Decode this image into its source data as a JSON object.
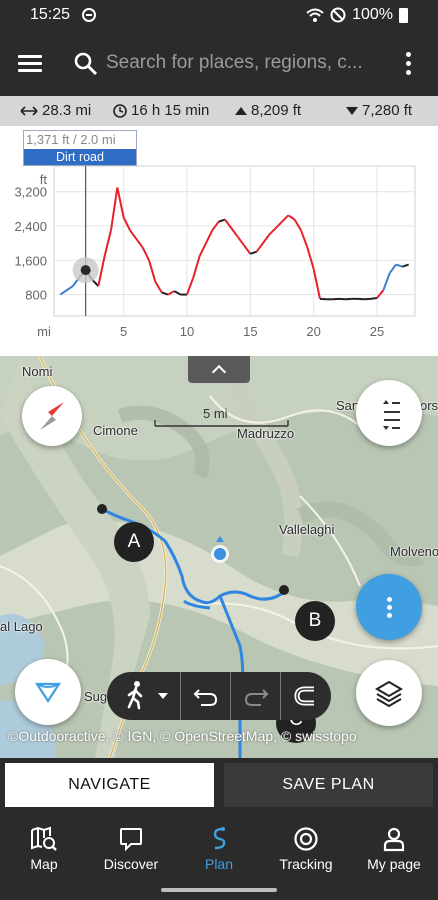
{
  "status_bar": {
    "time": "15:25",
    "battery": "100%"
  },
  "app_bar": {
    "search_placeholder": "Search for places, regions, c..."
  },
  "stats": {
    "distance": "28.3 mi",
    "duration": "16 h 15 min",
    "ascent": "8,209 ft",
    "descent": "7,280 ft"
  },
  "tooltip": {
    "value": "1,371 ft / 2.0 mi",
    "surface": "Dirt road"
  },
  "chart_data": {
    "type": "line",
    "title": "",
    "xlabel": "mi",
    "ylabel": "ft",
    "xlim": [
      -0.5,
      28
    ],
    "ylim": [
      300,
      3800
    ],
    "x_ticks": [
      5,
      10,
      15,
      20,
      25
    ],
    "y_ticks": [
      800,
      1600,
      2400,
      3200
    ],
    "x": [
      0,
      1,
      1.5,
      2,
      2.5,
      3,
      3.5,
      4,
      4.5,
      5,
      5.5,
      6,
      6.5,
      7,
      7.5,
      8,
      8.5,
      9,
      9.5,
      10,
      10.5,
      11,
      11.5,
      12,
      12.5,
      13,
      13.5,
      14,
      14.5,
      15,
      15.5,
      16,
      16.5,
      17,
      17.5,
      18,
      18.5,
      19,
      19.5,
      20,
      20.5,
      21,
      21.5,
      22,
      22.5,
      23,
      23.5,
      24,
      24.5,
      25,
      25.5,
      26,
      26.5,
      27,
      27.5
    ],
    "elevation": [
      800,
      1000,
      1200,
      1371,
      1150,
      1000,
      1700,
      2300,
      3300,
      2600,
      2300,
      2100,
      1900,
      1600,
      1100,
      850,
      800,
      880,
      800,
      800,
      1200,
      1700,
      2000,
      2300,
      2500,
      2550,
      2350,
      2150,
      1950,
      1750,
      1800,
      2000,
      2200,
      2350,
      2500,
      2650,
      2550,
      2300,
      1900,
      1400,
      700,
      690,
      690,
      700,
      690,
      700,
      700,
      690,
      700,
      720,
      900,
      1300,
      1500,
      1450,
      1500
    ],
    "series_colors": {
      "climb": "#e8202a",
      "flat": "#222222",
      "descent": "#3a7fd0"
    },
    "selected": {
      "x": 2.0,
      "y": 1371
    }
  },
  "map": {
    "labels": [
      "Nomi",
      "Cimone",
      "Madruzzo",
      "Vallelaghi",
      "Molveno",
      "San",
      "orso",
      "al Lago",
      "Sugana"
    ],
    "scale": "5 mi",
    "markers": [
      "A",
      "B",
      "C"
    ],
    "attribution": "©Outdooractive, © IGN, © OpenStreetMap, © swisstopo"
  },
  "actions": {
    "navigate": "NAVIGATE",
    "save_plan": "SAVE PLAN"
  },
  "nav": {
    "items": [
      {
        "label": "Map",
        "icon": "map-search-icon"
      },
      {
        "label": "Discover",
        "icon": "chat-bubble-icon"
      },
      {
        "label": "Plan",
        "icon": "route-plan-icon"
      },
      {
        "label": "Tracking",
        "icon": "record-icon"
      },
      {
        "label": "My page",
        "icon": "person-icon"
      }
    ],
    "active_color": "#3f9fe0"
  }
}
